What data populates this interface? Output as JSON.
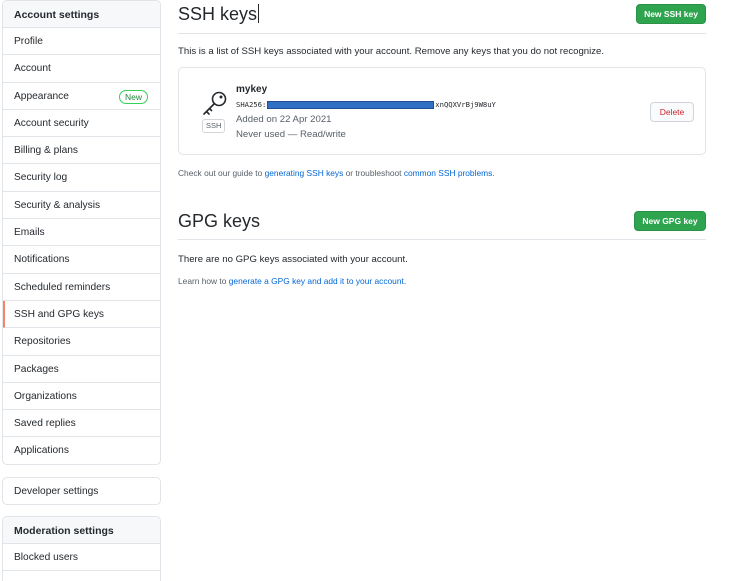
{
  "sidebar": {
    "header": "Account settings",
    "items": [
      {
        "label": "Profile"
      },
      {
        "label": "Account"
      },
      {
        "label": "Appearance",
        "badge": "New"
      },
      {
        "label": "Account security"
      },
      {
        "label": "Billing & plans"
      },
      {
        "label": "Security log"
      },
      {
        "label": "Security & analysis"
      },
      {
        "label": "Emails"
      },
      {
        "label": "Notifications"
      },
      {
        "label": "Scheduled reminders"
      },
      {
        "label": "SSH and GPG keys",
        "selected": true
      },
      {
        "label": "Repositories"
      },
      {
        "label": "Packages"
      },
      {
        "label": "Organizations"
      },
      {
        "label": "Saved replies"
      },
      {
        "label": "Applications"
      }
    ],
    "developer": "Developer settings",
    "moderation_header": "Moderation settings",
    "moderation_items": [
      {
        "label": "Blocked users"
      }
    ]
  },
  "ssh": {
    "title": "SSH keys",
    "new_button": "New SSH key",
    "description": "This is a list of SSH keys associated with your account. Remove any keys that you do not recognize.",
    "key": {
      "name": "mykey",
      "tag": "SSH",
      "fingerprint_prefix": "SHA256:",
      "fingerprint_suffix": "xnQQXVrBj9W8uY",
      "added": "Added on 22 Apr 2021",
      "usage": "Never used — Read/write",
      "delete_label": "Delete"
    },
    "guide_pre": "Check out our guide to ",
    "guide_link1": "generating SSH keys",
    "guide_mid": " or troubleshoot ",
    "guide_link2": "common SSH problems",
    "guide_post": "."
  },
  "gpg": {
    "title": "GPG keys",
    "new_button": "New GPG key",
    "empty": "There are no GPG keys associated with your account.",
    "learn_pre": "Learn how to ",
    "learn_link": "generate a GPG key and add it to your account",
    "learn_post": "."
  },
  "colors": {
    "accent_green": "#2ea44f",
    "link_blue": "#0366d6",
    "danger_red": "#cb2431",
    "selected_border": "#f9826c"
  }
}
